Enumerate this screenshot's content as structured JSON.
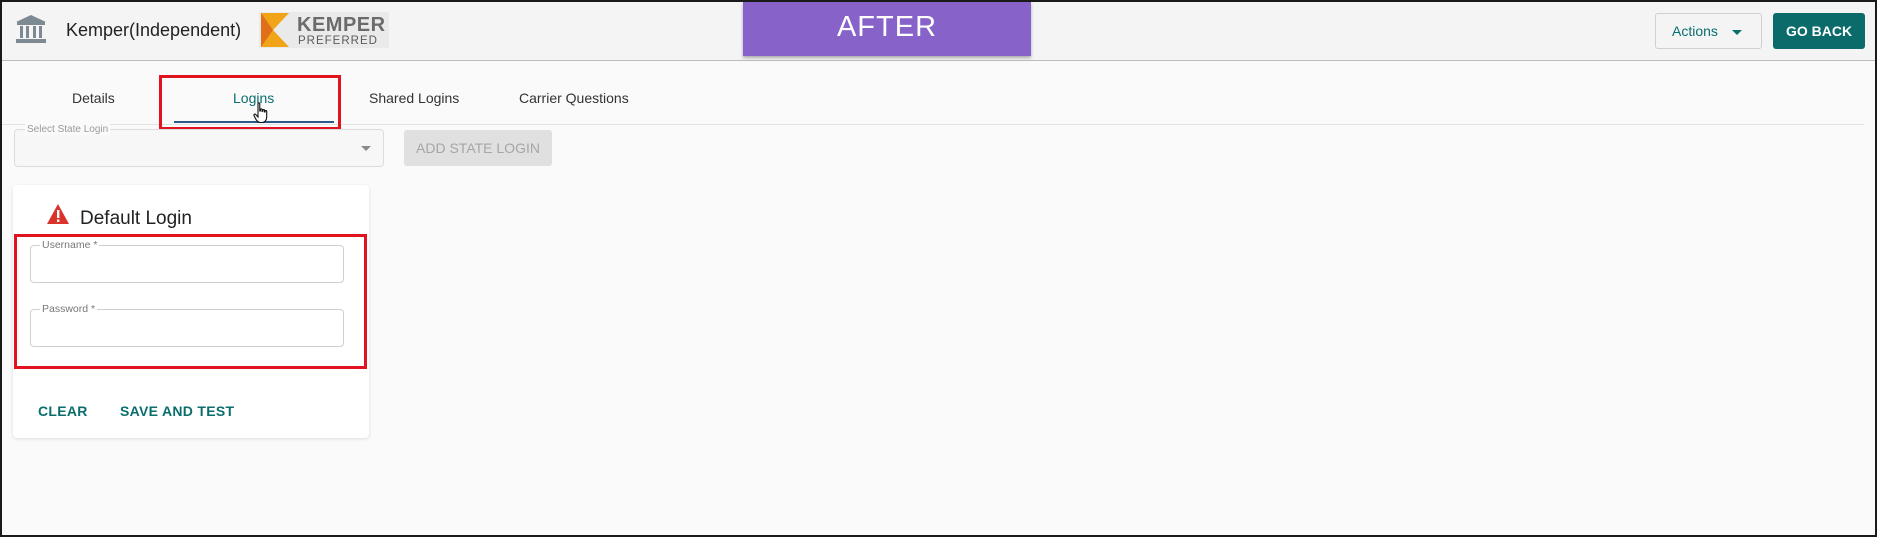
{
  "header": {
    "agency_name": "Kemper(Independent)",
    "logo_word": "KEMPER",
    "logo_sub": "PREFERRED",
    "banner": "AFTER",
    "actions_label": "Actions",
    "go_back_label": "GO BACK"
  },
  "tabs": [
    {
      "label": "Details",
      "active": false
    },
    {
      "label": "Logins",
      "active": true
    },
    {
      "label": "Shared Logins",
      "active": false
    },
    {
      "label": "Carrier Questions",
      "active": false
    }
  ],
  "state_login": {
    "placeholder": "Select State Login",
    "add_button": "ADD STATE LOGIN"
  },
  "card": {
    "title": "Default Login",
    "username_label": "Username *",
    "username_value": "",
    "password_label": "Password *",
    "password_value": "",
    "clear_label": "CLEAR",
    "save_label": "SAVE AND TEST"
  },
  "colors": {
    "accent": "#0b6e6e",
    "banner": "#8763c9",
    "highlight": "#e0141e",
    "warning": "#d9342b"
  },
  "icons": [
    "bank-icon",
    "chevron-down-icon",
    "warning-icon",
    "hand-cursor-icon"
  ]
}
